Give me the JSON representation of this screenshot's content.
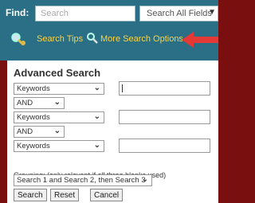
{
  "header": {
    "find_label": "Find:",
    "search_placeholder": "Search",
    "scope_value": "Search All Fields",
    "search_tips": "Search Tips",
    "more_options": "More Search Options"
  },
  "advanced": {
    "title": "Advanced Search",
    "rows": [
      {
        "field": "Keywords",
        "value": ""
      },
      {
        "field": "Keywords",
        "value": ""
      },
      {
        "field": "Keywords",
        "value": ""
      }
    ],
    "operators": [
      "AND",
      "AND"
    ],
    "grouping_label": "Grouping: (only relevant if all three blanks used)",
    "grouping_value": "Search 1 and Search 2, then Search 3",
    "buttons": {
      "search": "Search",
      "reset": "Reset",
      "cancel": "Cancel"
    }
  },
  "colors": {
    "header_bg": "#2a6f86",
    "link": "#ffd23a",
    "page_bg": "#7a0f0f",
    "arrow": "#e53935"
  }
}
